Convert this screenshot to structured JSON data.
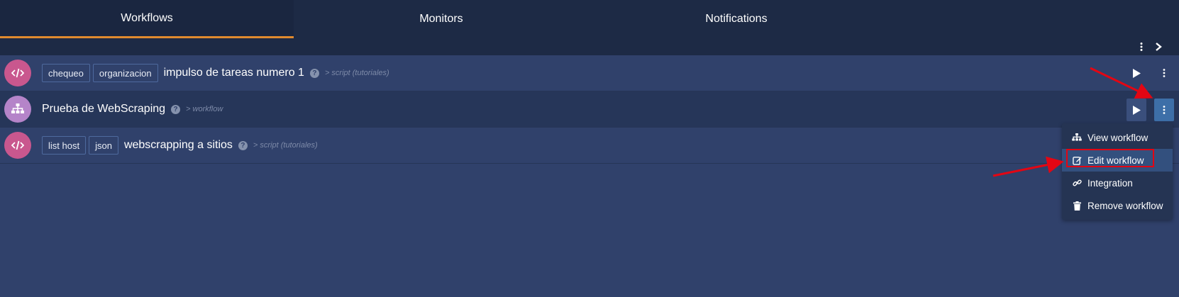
{
  "tabs": [
    {
      "label": "Workflows",
      "active": true
    },
    {
      "label": "Monitors",
      "active": false
    },
    {
      "label": "Notifications",
      "active": false
    }
  ],
  "toolbar": {
    "icons": [
      "vertical-dots-icon",
      "chevron-right-icon"
    ]
  },
  "rows": [
    {
      "icon": "code-icon",
      "tags": [
        "chequeo",
        "organizacion"
      ],
      "title": "impulso de tareas numero 1",
      "help": "?",
      "subtitle": "> script (tutoriales)"
    },
    {
      "icon": "sitemap-icon",
      "tags": [],
      "title": "Prueba de WebScraping",
      "help": "?",
      "subtitle": "> workflow"
    },
    {
      "icon": "code-icon",
      "tags": [
        "list host",
        "json"
      ],
      "title": "webscrapping a sitios",
      "help": "?",
      "subtitle": "> script (tutoriales)"
    }
  ],
  "menu": {
    "items": [
      {
        "label": "View workflow",
        "icon": "sitemap-icon"
      },
      {
        "label": "Edit workflow",
        "icon": "edit-icon",
        "highlighted": true
      },
      {
        "label": "Integration",
        "icon": "link-icon"
      },
      {
        "label": "Remove workflow",
        "icon": "trash-icon"
      }
    ]
  },
  "colors": {
    "background": "#30416b",
    "tabbar": "#1d2a45",
    "active_tab_underline": "#e08a2e",
    "script_icon": "#c9578e",
    "workflow_icon": "#b584c9",
    "annotation_red": "#e30613"
  }
}
